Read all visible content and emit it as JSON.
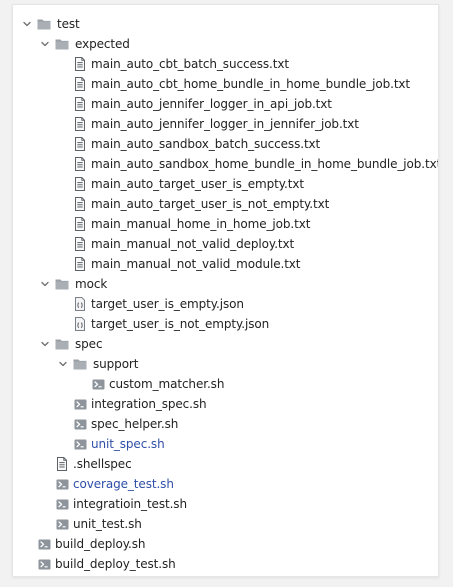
{
  "tree": {
    "root_folder": "test",
    "expected": {
      "folder": "expected",
      "files": [
        "main_auto_cbt_batch_success.txt",
        "main_auto_cbt_home_bundle_in_home_bundle_job.txt",
        "main_auto_jennifer_logger_in_api_job.txt",
        "main_auto_jennifer_logger_in_jennifer_job.txt",
        "main_auto_sandbox_batch_success.txt",
        "main_auto_sandbox_home_bundle_in_home_bundle_job.txt",
        "main_auto_target_user_is_empty.txt",
        "main_auto_target_user_is_not_empty.txt",
        "main_manual_home_in_home_job.txt",
        "main_manual_not_valid_deploy.txt",
        "main_manual_not_valid_module.txt"
      ]
    },
    "mock": {
      "folder": "mock",
      "files": [
        "target_user_is_empty.json",
        "target_user_is_not_empty.json"
      ]
    },
    "spec": {
      "folder": "spec",
      "support_folder": "support",
      "support_files": [
        "custom_matcher.sh"
      ],
      "files": [
        "integration_spec.sh",
        "spec_helper.sh",
        "unit_spec.sh"
      ]
    },
    "test_files": [
      ".shellspec",
      "coverage_test.sh",
      "integratioin_test.sh",
      "unit_test.sh"
    ],
    "root_files": [
      "build_deploy.sh",
      "build_deploy_test.sh"
    ]
  },
  "colors": {
    "vcs_modified_text": "#2f4fa8",
    "folder_icon": "#9aa0a6"
  }
}
